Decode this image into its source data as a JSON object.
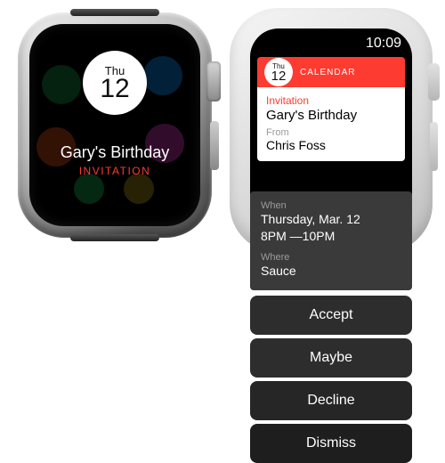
{
  "left": {
    "dow": "Thu",
    "day": "12",
    "event_title": "Gary's Birthday",
    "event_subtitle": "INVITATION"
  },
  "right": {
    "status_time": "10:09",
    "app_label": "CALENDAR",
    "mini_dow": "Thu",
    "mini_day": "12",
    "invitation_label": "Invitation",
    "event_title": "Gary's Birthday",
    "from_label": "From",
    "from_name": "Chris Foss",
    "when_label": "When",
    "when_value_line1": "Thursday, Mar. 12",
    "when_value_line2": "8PM —10PM",
    "where_label": "Where",
    "where_value": "Sauce",
    "actions": {
      "accept": "Accept",
      "maybe": "Maybe",
      "decline": "Decline",
      "dismiss": "Dismiss"
    }
  }
}
